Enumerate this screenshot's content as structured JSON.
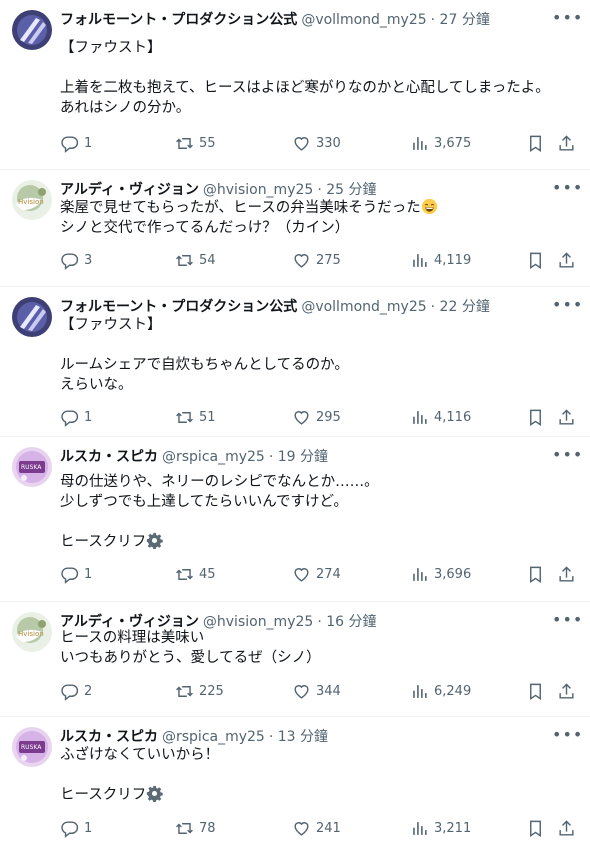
{
  "tweets": [
    {
      "name": "フォルモーント・プロダクション公式",
      "handle": "@vollmond_my25",
      "time": "· 27 分鐘",
      "lines": [
        "【ファウスト】",
        "",
        "上着を二枚も抱えて、ヒースはよほど寒がりなのかと心配してしまったよ。",
        "あれはシノの分か。"
      ],
      "replies": "1",
      "retweets": "55",
      "likes": "330",
      "views": "3,675"
    },
    {
      "name": "アルディ・ヴィジョン",
      "handle": "@hvision_my25",
      "time": "· 25 分鐘",
      "lines": [
        "楽屋で見せてもらったが、ヒースの弁当美味そうだった",
        "シノと交代で作ってるんだっけ？（カイン）"
      ],
      "replies": "3",
      "retweets": "54",
      "likes": "275",
      "views": "4,119"
    },
    {
      "name": "フォルモーント・プロダクション公式",
      "handle": "@vollmond_my25",
      "time": "· 22 分鐘",
      "lines": [
        "【ファウスト】",
        "",
        "ルームシェアで自炊もちゃんとしてるのか。",
        "えらいな。"
      ],
      "replies": "1",
      "retweets": "51",
      "likes": "295",
      "views": "4,116"
    },
    {
      "name": "ルスカ・スピカ",
      "handle": "@rspica_my25",
      "time": "· 19 分鐘",
      "lines": [
        "母の仕送りや、ネリーのレシピでなんとか……。",
        "少しずつでも上達してたらいいんですけど。",
        "",
        "ヒースクリフ"
      ],
      "replies": "1",
      "retweets": "45",
      "likes": "274",
      "views": "3,696"
    },
    {
      "name": "アルディ・ヴィジョン",
      "handle": "@hvision_my25",
      "time": "· 16 分鐘",
      "lines": [
        "ヒースの料理は美味い",
        "いつもありがとう、愛してるぜ（シノ）"
      ],
      "replies": "2",
      "retweets": "225",
      "likes": "344",
      "views": "6,249"
    },
    {
      "name": "ルスカ・スピカ",
      "handle": "@rspica_my25",
      "time": "· 13 分鐘",
      "lines": [
        "ふざけなくていいから！",
        "",
        "ヒースクリフ"
      ],
      "replies": "1",
      "retweets": "78",
      "likes": "241",
      "views": "3,211"
    }
  ],
  "icons": {
    "more": "more-icon",
    "reply": "reply-icon",
    "retweet": "retweet-icon",
    "like": "like-icon",
    "views": "views-icon",
    "bookmark": "bookmark-icon",
    "share": "share-icon",
    "gear": "gear-icon",
    "grin": "grinning-emoji-icon"
  },
  "colors": {
    "text": "#0f1419",
    "muted": "#536471",
    "thread": "#cfd9de",
    "divider": "#eff3f4"
  }
}
